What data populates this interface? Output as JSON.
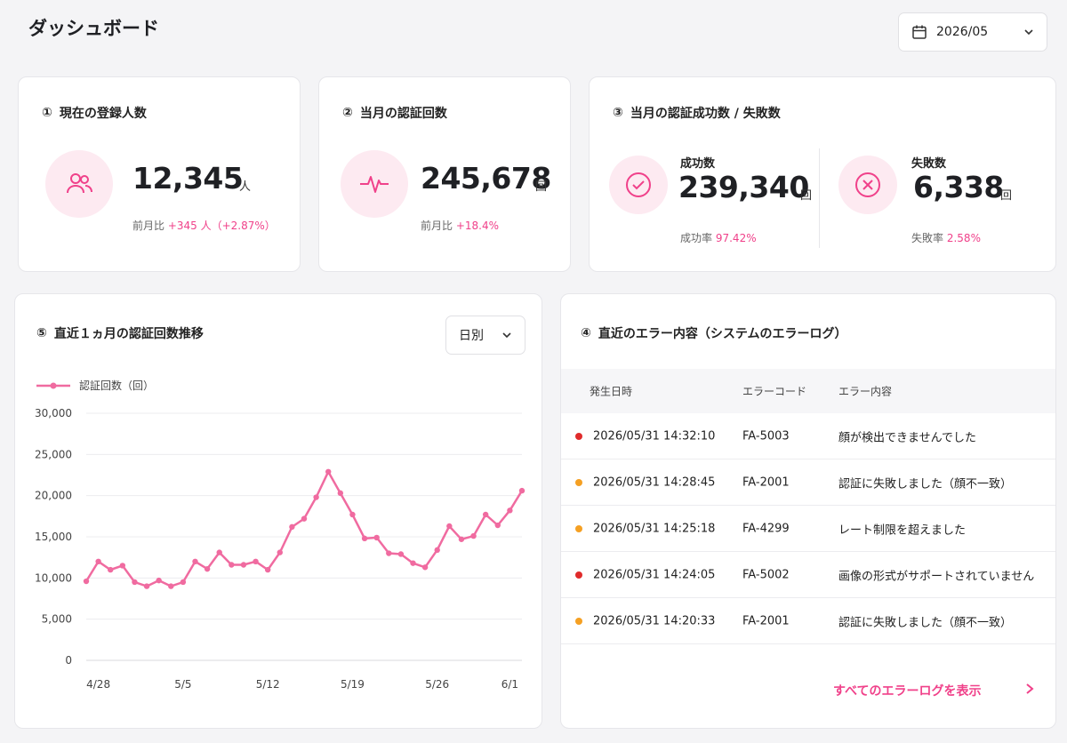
{
  "header": {
    "title": "ダッシュボード"
  },
  "month_select": {
    "value": "2026/05"
  },
  "registered": {
    "badge": "①",
    "title": "現在の登録人数",
    "value": "12,345",
    "unit": "人",
    "compare_label": "前月比",
    "compare_value": "+345 人（+2.87%）"
  },
  "auth_count": {
    "badge": "②",
    "title": "当月の認証回数",
    "value": "245,678",
    "unit": "回",
    "compare_label": "前月比",
    "compare_value": "+18.4%"
  },
  "auth_result": {
    "badge": "③",
    "title": "当月の認証成功数 / 失敗数",
    "success": {
      "label": "成功数",
      "value": "239,340",
      "unit": "回",
      "rate_label": "成功率",
      "rate_value": "97.42%"
    },
    "failure": {
      "label": "失敗数",
      "value": "6,338",
      "unit": "回",
      "rate_label": "失敗率",
      "rate_value": "2.58%"
    }
  },
  "trend": {
    "badge": "⑤",
    "title": "直近１ヵ月の認証回数推移",
    "period_value": "日別"
  },
  "chart_data": {
    "type": "line",
    "title": "",
    "xlabel": "",
    "ylabel": "",
    "ylim": [
      0,
      30000
    ],
    "yticks": [
      0,
      5000,
      10000,
      15000,
      20000,
      25000,
      30000
    ],
    "ytick_labels": [
      "0",
      "5,000",
      "10,000",
      "15,000",
      "20,000",
      "25,000",
      "30,000"
    ],
    "xticks": [
      {
        "index": 1,
        "label": "4/28"
      },
      {
        "index": 8,
        "label": "5/5"
      },
      {
        "index": 15,
        "label": "5/12"
      },
      {
        "index": 22,
        "label": "5/19"
      },
      {
        "index": 29,
        "label": "5/26"
      },
      {
        "index": 35,
        "label": "6/1"
      }
    ],
    "grid": true,
    "legend": "top-left",
    "x_start": "4/27",
    "series": [
      {
        "name": "認証回数（回）",
        "color": "#f06ba0",
        "values": [
          9600,
          12000,
          11000,
          11500,
          9500,
          9000,
          9700,
          9000,
          9500,
          12000,
          11100,
          13100,
          11600,
          11600,
          12000,
          11000,
          13100,
          16200,
          17200,
          19800,
          22900,
          20300,
          17700,
          14800,
          14900,
          13000,
          12900,
          11800,
          11300,
          13400,
          16300,
          14700,
          15100,
          17700,
          16400,
          18200,
          20600
        ]
      }
    ]
  },
  "errors": {
    "badge": "④",
    "title": "直近のエラー内容（システムのエラーログ）",
    "columns": [
      "発生日時",
      "エラーコード",
      "エラー内容"
    ],
    "rows": [
      {
        "datetime": "2026/05/31 14:32:10",
        "code": "FA-5003",
        "message": "顔が検出できませんでした",
        "level": "error"
      },
      {
        "datetime": "2026/05/31 14:28:45",
        "code": "FA-2001",
        "message": "認証に失敗しました（顔不一致）",
        "level": "warning"
      },
      {
        "datetime": "2026/05/31 14:25:18",
        "code": "FA-4299",
        "message": "レート制限を超えました",
        "level": "warning"
      },
      {
        "datetime": "2026/05/31 14:24:05",
        "code": "FA-5002",
        "message": "画像の形式がサポートされていません",
        "level": "error"
      },
      {
        "datetime": "2026/05/31 14:20:33",
        "code": "FA-2001",
        "message": "認証に失敗しました（顔不一致）",
        "level": "warning"
      }
    ],
    "view_all": "すべてのエラーログを表示"
  },
  "colors": {
    "accent": "#f0418a",
    "accent_light": "#fdeaf1",
    "error": "#e02b2b",
    "warning": "#f5a023"
  }
}
